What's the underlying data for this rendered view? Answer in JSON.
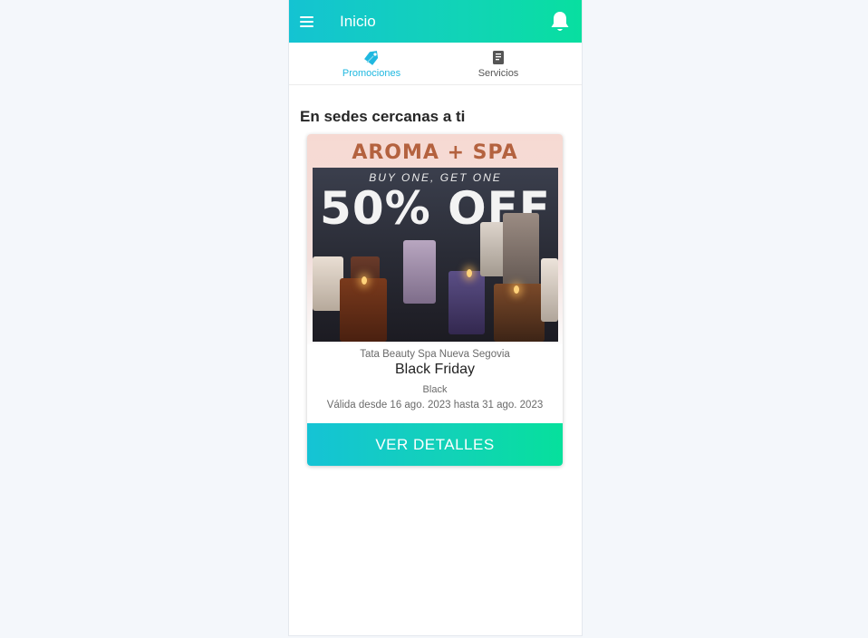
{
  "header": {
    "title": "Inicio",
    "menu_icon": "hamburger-menu-icon",
    "notification_icon": "bell-icon",
    "gradient": [
      "#14c3d2",
      "#08dfa0"
    ]
  },
  "tabs": [
    {
      "label": "Promociones",
      "icon": "tag-icon",
      "active": true
    },
    {
      "label": "Servicios",
      "icon": "document-icon",
      "active": false
    }
  ],
  "section": {
    "title": "En sedes cercanas a ti"
  },
  "promo": {
    "image": {
      "brand": "AROMA + SPA",
      "headline": "BUY ONE, GET ONE",
      "discount": "50% OFF"
    },
    "store": "Tata Beauty Spa Nueva Segovia",
    "title": "Black Friday",
    "subtitle": "Black",
    "validity": "Válida desde 16 ago. 2023 hasta 31 ago. 2023",
    "button_label": "VER DETALLES"
  },
  "colors": {
    "accent": "#1fb8e0",
    "background": "#f4f7fb"
  }
}
